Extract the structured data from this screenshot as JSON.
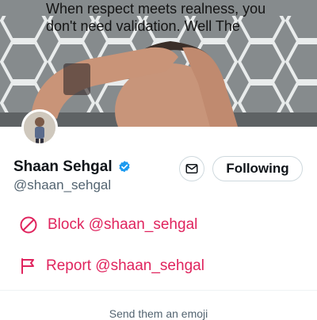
{
  "banner": {
    "caption": "When respect meets realness, you don't need validation. Well The"
  },
  "profile": {
    "display_name": "Shaan Sehgal",
    "handle": "@shaan_sehgal",
    "verified": true,
    "verified_color": "#1d9bf0"
  },
  "actions": {
    "following_label": "Following",
    "dm_icon": "envelope-icon"
  },
  "menu": {
    "block_label": "Block @shaan_sehgal",
    "report_label": "Report @shaan_sehgal",
    "danger_color": "#e0245e"
  },
  "footer": {
    "emoji_hint": "Send them an emoji"
  }
}
